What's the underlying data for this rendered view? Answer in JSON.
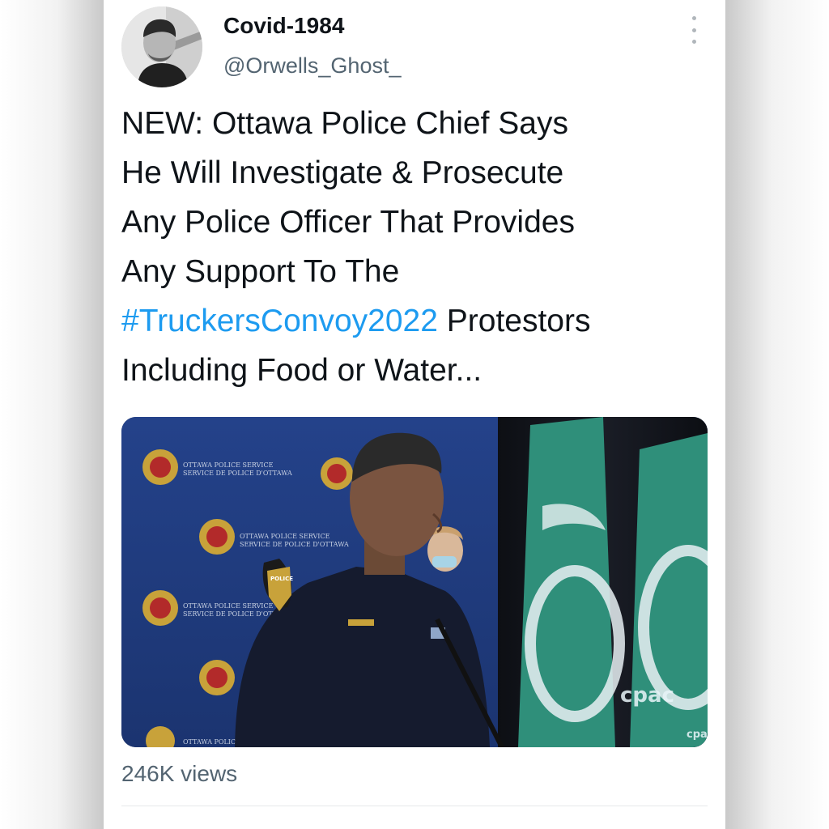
{
  "tweet": {
    "author": {
      "display_name": "Covid-1984",
      "handle": "@Orwells_Ghost_"
    },
    "text_lines": [
      "NEW: Ottawa Police Chief Says",
      "He Will Investigate & Prosecute",
      "Any Police Officer That Provides",
      "Any Support To The"
    ],
    "hashtag": "#TruckersConvoy2022",
    "text_after_hashtag": " Protestors",
    "text_last_line": "Including Food or Water...",
    "views": "246K views"
  },
  "media": {
    "backdrop_line1": "OTTAWA POLICE SERVICE",
    "backdrop_line2": "SERVICE DE POLICE D'OTTAWA",
    "patch_text": "POLICE",
    "watermark": "cpac",
    "watermark_small": "cpac"
  },
  "colors": {
    "hashtag": "#1d9bf0",
    "text": "#0f1419",
    "secondary": "#536471",
    "backdrop_blue": "#1f3a78",
    "flag_teal": "#2f8f7a"
  },
  "icons": {
    "more": "vertical-ellipsis-icon"
  }
}
